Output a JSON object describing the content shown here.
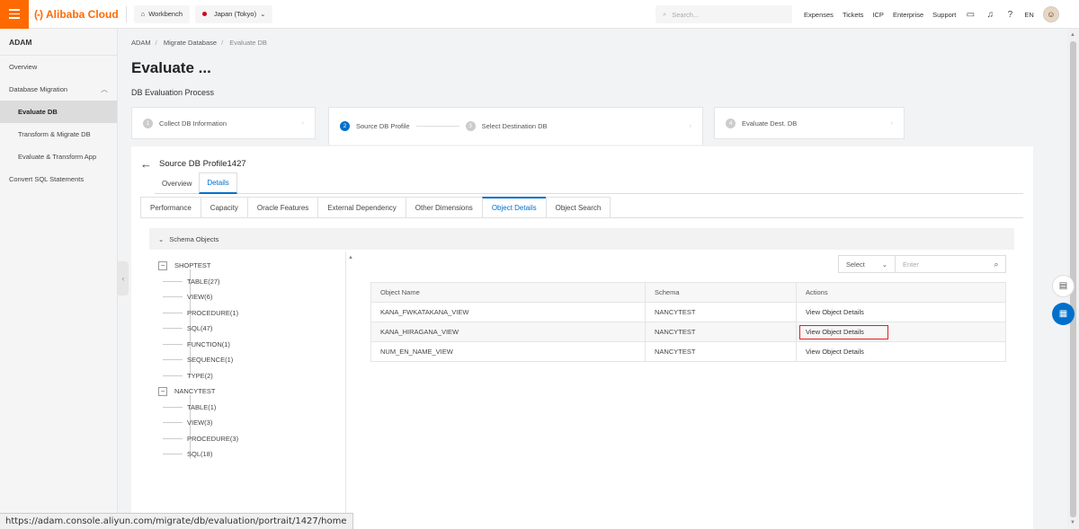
{
  "topbar": {
    "brand": "Alibaba Cloud",
    "brand_mark": "(-)",
    "workbench": "Workbench",
    "region": "Japan (Tokyo)",
    "search_placeholder": "Search...",
    "links": [
      "Expenses",
      "Tickets",
      "ICP",
      "Enterprise",
      "Support"
    ],
    "lang": "EN"
  },
  "sidebar": {
    "title": "ADAM",
    "items": [
      {
        "label": "Overview"
      },
      {
        "label": "Database Migration"
      },
      {
        "label": "Evaluate DB"
      },
      {
        "label": "Transform & Migrate DB"
      },
      {
        "label": "Evaluate & Transform App"
      },
      {
        "label": "Convert SQL Statements"
      }
    ]
  },
  "breadcrumb": [
    "ADAM",
    "Migrate Database",
    "Evaluate DB"
  ],
  "page_title": "Evaluate ...",
  "process_title": "DB Evaluation Process",
  "steps": [
    {
      "num": "1",
      "label": "Collect DB Information"
    },
    {
      "num": "2",
      "label": "Source DB Profile"
    },
    {
      "num": "3",
      "label": "Select Destination DB"
    },
    {
      "num": "4",
      "label": "Evaluate Dest. DB"
    }
  ],
  "profile_title": "Source DB Profile1427",
  "tabs_main": [
    "Overview",
    "Details"
  ],
  "tabs_detail": [
    "Performance",
    "Capacity",
    "Oracle Features",
    "External Dependency",
    "Other Dimensions",
    "Object Details",
    "Object Search"
  ],
  "schema_section": "Schema Objects",
  "tree": [
    {
      "name": "SHOPTEST",
      "children": [
        "TABLE(27)",
        "VIEW(6)",
        "PROCEDURE(1)",
        "SQL(47)",
        "FUNCTION(1)",
        "SEQUENCE(1)",
        "TYPE(2)"
      ]
    },
    {
      "name": "NANCYTEST",
      "children": [
        "TABLE(1)",
        "VIEW(3)",
        "PROCEDURE(3)",
        "SQL(18)"
      ]
    }
  ],
  "filter": {
    "select": "Select",
    "placeholder": "Enter"
  },
  "table": {
    "headers": [
      "Object Name",
      "Schema",
      "Actions"
    ],
    "rows": [
      {
        "name": "KANA_FWKATAKANA_VIEW",
        "schema": "NANCYTEST",
        "action": "View Object Details"
      },
      {
        "name": "KANA_HIRAGANA_VIEW",
        "schema": "NANCYTEST",
        "action": "View Object Details"
      },
      {
        "name": "NUM_EN_NAME_VIEW",
        "schema": "NANCYTEST",
        "action": "View Object Details"
      }
    ]
  },
  "status_url": "https://adam.console.aliyun.com/migrate/db/evaluation/portrait/1427/home"
}
